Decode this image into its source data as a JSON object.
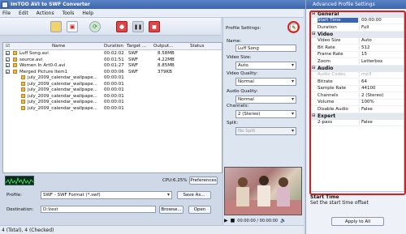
{
  "window": {
    "title": "ImTOO AVI to SWF Converter"
  },
  "menu": [
    "File",
    "Edit",
    "Actions",
    "Tools",
    "Help"
  ],
  "toolbar": {
    "icons": [
      "add-folder-icon",
      "add-file-icon",
      "remove-icon",
      "convert-icon",
      "record-icon",
      "pause-icon",
      "stop-icon"
    ]
  },
  "filelist": {
    "headers": {
      "name": "Name",
      "duration": "Duration",
      "target": "Target ...",
      "output": "Output...",
      "status": "Status"
    },
    "rows": [
      {
        "name": "Luff Song.avi",
        "duration": "00:02:02",
        "target": "SWF",
        "output": "8.58MB",
        "checked": true
      },
      {
        "name": "source.avi",
        "duration": "00:01:51",
        "target": "SWF",
        "output": "4.22MB",
        "checked": true
      },
      {
        "name": "Women In Art0-0.avi",
        "duration": "00:01:27",
        "target": "SWF",
        "output": "8.85MB",
        "checked": true
      },
      {
        "name": "Merged Picture Item1",
        "duration": "00:00:06",
        "target": "SWF",
        "output": "379KB",
        "checked": true
      },
      {
        "name": "july_2009_calendar_wallpape...",
        "duration": "00:00:01",
        "target": "",
        "output": "",
        "checked": false
      },
      {
        "name": "july_2009_calendar_wallpape...",
        "duration": "00:00:01",
        "target": "",
        "output": "",
        "checked": false
      },
      {
        "name": "july_2009_calendar_wallpape...",
        "duration": "00:00:01",
        "target": "",
        "output": "",
        "checked": false
      },
      {
        "name": "july_2009_calendar_wallpape...",
        "duration": "00:00:01",
        "target": "",
        "output": "",
        "checked": false
      },
      {
        "name": "july_2009_calendar_wallpape...",
        "duration": "00:00:01",
        "target": "",
        "output": "",
        "checked": false
      },
      {
        "name": "july_2009_calendar_wallpape...",
        "duration": "00:00:01",
        "target": "",
        "output": "",
        "checked": false
      }
    ]
  },
  "cpu": "CPU:6.25%",
  "preferences_label": "Preferences",
  "bottom": {
    "profile_label": "Profile:",
    "profile_value": "SWF - SWF Format (*.swf)",
    "save_as_label": "Save As...",
    "destination_label": "Destination:",
    "destination_value": "D:\\test",
    "browse_label": "Browse...",
    "open_label": "Open"
  },
  "status": "4 (Total), 4 (Checked)",
  "profile_settings": {
    "title": "Profile Settings:",
    "name_label": "Name:",
    "name_value": "Luff Song",
    "video_size_label": "Video Size:",
    "video_size_value": "Auto",
    "video_quality_label": "Video Quality:",
    "video_quality_value": "Normal",
    "audio_quality_label": "Audio Quality:",
    "audio_quality_value": "Normal",
    "channels_label": "Channels:",
    "channels_value": "2 (Stereo)",
    "split_label": "Split:",
    "split_value": "No Split"
  },
  "player": {
    "time": "00:00:00 / 00:00:00"
  },
  "advanced": {
    "title": "Advanced Profile Settings",
    "sections": [
      {
        "name": "General",
        "rows": [
          {
            "k": "Start Time",
            "v": "00:00:00",
            "selected": true
          },
          {
            "k": "Duration",
            "v": "Full"
          }
        ]
      },
      {
        "name": "Video",
        "rows": [
          {
            "k": "Video Size",
            "v": "Auto"
          },
          {
            "k": "Bit Rate",
            "v": "512"
          },
          {
            "k": "Frame Rate",
            "v": "15"
          },
          {
            "k": "Zoom",
            "v": "Letterbox"
          }
        ]
      },
      {
        "name": "Audio",
        "rows": [
          {
            "k": "Audio Codec",
            "v": "mp3",
            "disabled": true
          },
          {
            "k": "Bitrate",
            "v": "64"
          },
          {
            "k": "Sample Rate",
            "v": "44100"
          },
          {
            "k": "Channels",
            "v": "2 (Stereo)"
          },
          {
            "k": "Volume",
            "v": "100%"
          },
          {
            "k": "Disable Audio",
            "v": "False"
          }
        ]
      },
      {
        "name": "Expert",
        "rows": [
          {
            "k": "2-pass",
            "v": "False"
          }
        ]
      }
    ],
    "desc_title": "Start Time",
    "desc_text": "Set the start time offset",
    "apply_label": "Apply to All"
  },
  "colors": {
    "accent": "#3a64ad",
    "highlight": "#d62020"
  }
}
